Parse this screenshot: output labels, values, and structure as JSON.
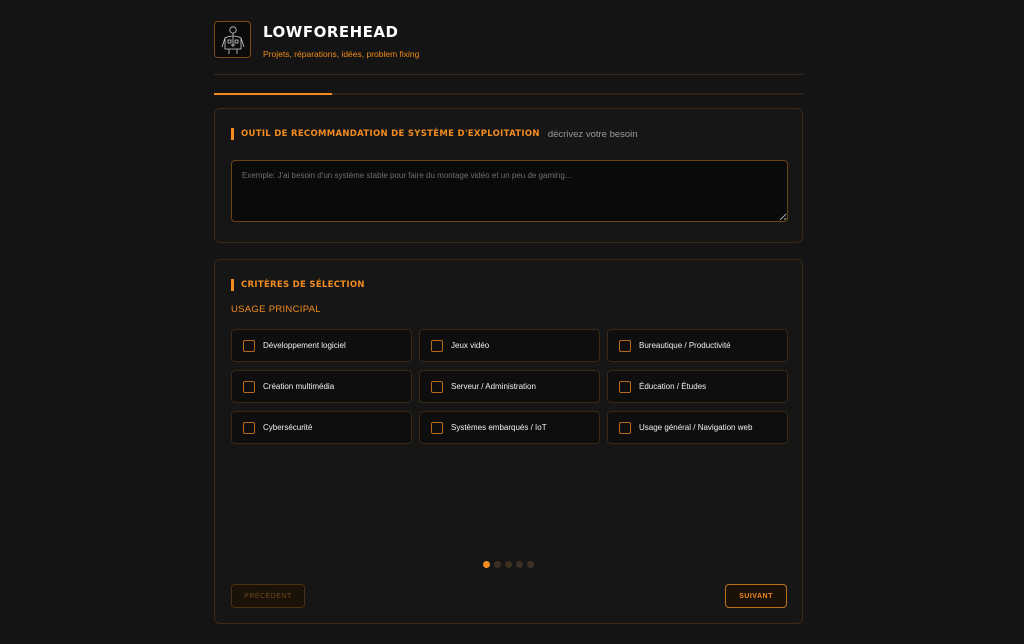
{
  "brand": {
    "title": "LOWFOREHEAD",
    "subtitle": "Projets, réparations, idées, problem fixing",
    "logo_icon": "circuit-body-icon"
  },
  "progress": {
    "step": 1,
    "total": 5,
    "fraction": 0.2
  },
  "recommend": {
    "title": "OUTIL DE RECOMMANDATION DE SYSTÈME D'EXPLOITATION",
    "hint": "décrivez votre besoin",
    "placeholder": "Exemple: J'ai besoin d'un système stable pour faire du montage vidéo et un peu de gaming...",
    "value": ""
  },
  "criteria": {
    "title": "CRITÈRES DE SÉLECTION",
    "usage_label": "USAGE PRINCIPAL",
    "options": [
      {
        "label": "Développement logiciel",
        "checked": false
      },
      {
        "label": "Jeux vidéo",
        "checked": false
      },
      {
        "label": "Bureautique / Productivité",
        "checked": false
      },
      {
        "label": "Création multimédia",
        "checked": false
      },
      {
        "label": "Serveur / Administration",
        "checked": false
      },
      {
        "label": "Éducation / Études",
        "checked": false
      },
      {
        "label": "Cybersécurité",
        "checked": false
      },
      {
        "label": "Systèmes embarqués / IoT",
        "checked": false
      },
      {
        "label": "Usage général / Navigation web",
        "checked": false
      }
    ]
  },
  "pagination": {
    "current": 1,
    "count": 5
  },
  "nav": {
    "prev_label": "PRÉCÉDENT",
    "next_label": "SUIVANT"
  },
  "colors": {
    "accent": "#f28c1f",
    "background": "#141414",
    "card_border": "#3d2a14"
  }
}
